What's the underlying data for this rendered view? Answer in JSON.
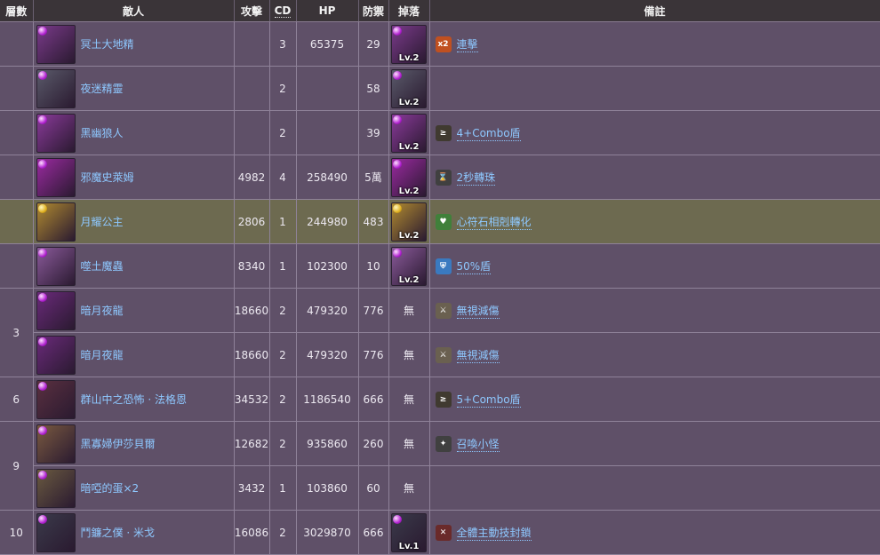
{
  "headers": {
    "floor": "層數",
    "enemy": "敵人",
    "atk": "攻擊",
    "cd": "CD",
    "hp": "HP",
    "def": "防禦",
    "drop": "掉落",
    "note": "備註"
  },
  "rows": [
    {
      "floor": "",
      "name": "冥土大地精",
      "atk": "",
      "cd": "3",
      "hp": "65375",
      "def": "29",
      "drop": "Lv.2",
      "note": "連擊",
      "note_icon": "combo-x2-icon",
      "icon_color": "#7a3a8a",
      "attr": "dark"
    },
    {
      "floor": "",
      "name": "夜迷精靈",
      "atk": "",
      "cd": "2",
      "hp": "",
      "def": "58",
      "drop": "Lv.2",
      "note": "",
      "note_icon": "",
      "icon_color": "#5a5a6a",
      "attr": "dark"
    },
    {
      "floor": "",
      "name": "黑幽狼人",
      "atk": "",
      "cd": "2",
      "hp": "",
      "def": "39",
      "drop": "Lv.2",
      "note": "4+Combo盾",
      "note_icon": "combo-shield-icon",
      "icon_color": "#8a3a9a",
      "attr": "dark"
    },
    {
      "floor": "",
      "name": "邪魔史萊姆",
      "atk": "4982",
      "cd": "4",
      "hp": "258490",
      "def": "5萬",
      "drop": "Lv.2",
      "note": "2秒轉珠",
      "note_icon": "hourglass-icon",
      "icon_color": "#9a2aa0",
      "attr": "dark"
    },
    {
      "floor": "",
      "name": "月耀公主",
      "atk": "2806",
      "cd": "1",
      "hp": "244980",
      "def": "483",
      "drop": "Lv.2",
      "note": "心符石相剋轉化",
      "note_icon": "heart-rune-icon",
      "icon_color": "#b08a30",
      "attr": "light",
      "highlight": true
    },
    {
      "floor": "",
      "name": "噬土魔蟲",
      "atk": "8340",
      "cd": "1",
      "hp": "102300",
      "def": "10",
      "drop": "Lv.2",
      "note": "50%盾",
      "note_icon": "shield-icon",
      "icon_color": "#8a5a9a",
      "attr": "dark"
    },
    {
      "floor": "3",
      "name": "暗月夜龍",
      "atk": "18660",
      "cd": "2",
      "hp": "479320",
      "def": "776",
      "drop": "無",
      "note": "無視減傷",
      "note_icon": "pierce-icon",
      "icon_color": "#6a2a7a",
      "attr": "dark"
    },
    {
      "floor": "",
      "name": "暗月夜龍",
      "atk": "18660",
      "cd": "2",
      "hp": "479320",
      "def": "776",
      "drop": "無",
      "note": "無視減傷",
      "note_icon": "pierce-icon",
      "icon_color": "#6a2a7a",
      "attr": "dark"
    },
    {
      "floor": "6",
      "name": "群山中之恐怖 · 法格恩",
      "atk": "34532",
      "cd": "2",
      "hp": "1186540",
      "def": "666",
      "drop": "無",
      "note": "5+Combo盾",
      "note_icon": "combo-shield-icon",
      "icon_color": "#5a3040",
      "attr": "dark"
    },
    {
      "floor": "9",
      "name": "黑寡婦伊莎貝爾",
      "atk": "12682",
      "cd": "2",
      "hp": "935860",
      "def": "260",
      "drop": "無",
      "note": "召喚小怪",
      "note_icon": "summon-icon",
      "icon_color": "#7a5a40",
      "attr": "dark"
    },
    {
      "floor": "",
      "name": "暗啞的蛋×2",
      "atk": "3432",
      "cd": "1",
      "hp": "103860",
      "def": "60",
      "drop": "無",
      "note": "",
      "note_icon": "",
      "icon_color": "#6a5a40",
      "attr": "dark"
    },
    {
      "floor": "10",
      "name": "鬥鐮之僕 · 米戈",
      "atk": "16086",
      "cd": "2",
      "hp": "3029870",
      "def": "666",
      "drop": "Lv.1",
      "note": "全體主動技封鎖",
      "note_icon": "skill-lock-icon",
      "icon_color": "#3a3a4a",
      "attr": "dark"
    }
  ],
  "colors": {
    "row_bg": "#5f5068",
    "highlight_bg": "#6d6a50",
    "header_bg": "#3a3438",
    "link": "#8ec8ff"
  }
}
